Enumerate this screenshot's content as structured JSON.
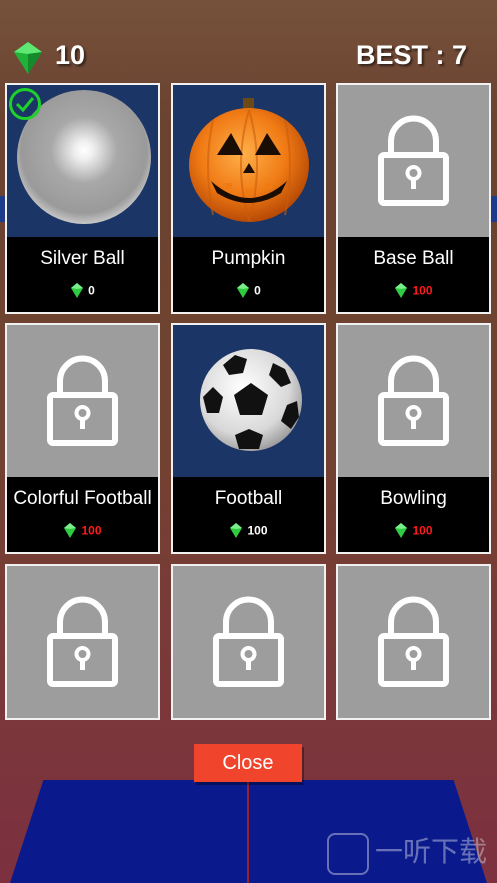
{
  "hud": {
    "gem_icon": "green-gem-icon",
    "gem_count": "10",
    "best_score": "BEST : 7"
  },
  "shop": {
    "items": [
      {
        "name": "Silver Ball",
        "price": "0",
        "state": "selected",
        "art": "silver-ball"
      },
      {
        "name": "Pumpkin",
        "price": "0",
        "state": "owned",
        "art": "pumpkin"
      },
      {
        "name": "Base Ball",
        "price": "100",
        "state": "locked"
      },
      {
        "name": "Colorful Football",
        "price": "100",
        "state": "locked"
      },
      {
        "name": "Football",
        "price": "100",
        "state": "owned",
        "art": "soccer-ball"
      },
      {
        "name": "Bowling",
        "price": "100",
        "state": "locked"
      },
      {
        "name": "",
        "price": "",
        "state": "locked"
      },
      {
        "name": "",
        "price": "",
        "state": "locked"
      },
      {
        "name": "",
        "price": "",
        "state": "locked"
      }
    ]
  },
  "close_label": "Close",
  "watermark": "一听下载",
  "colors": {
    "affordable_price": "#ffffff",
    "unaffordable_price": "#ff1a1a",
    "gem": "#2ecc40",
    "close_button": "#f0442c",
    "locked_tile": "#9d9d9d"
  }
}
